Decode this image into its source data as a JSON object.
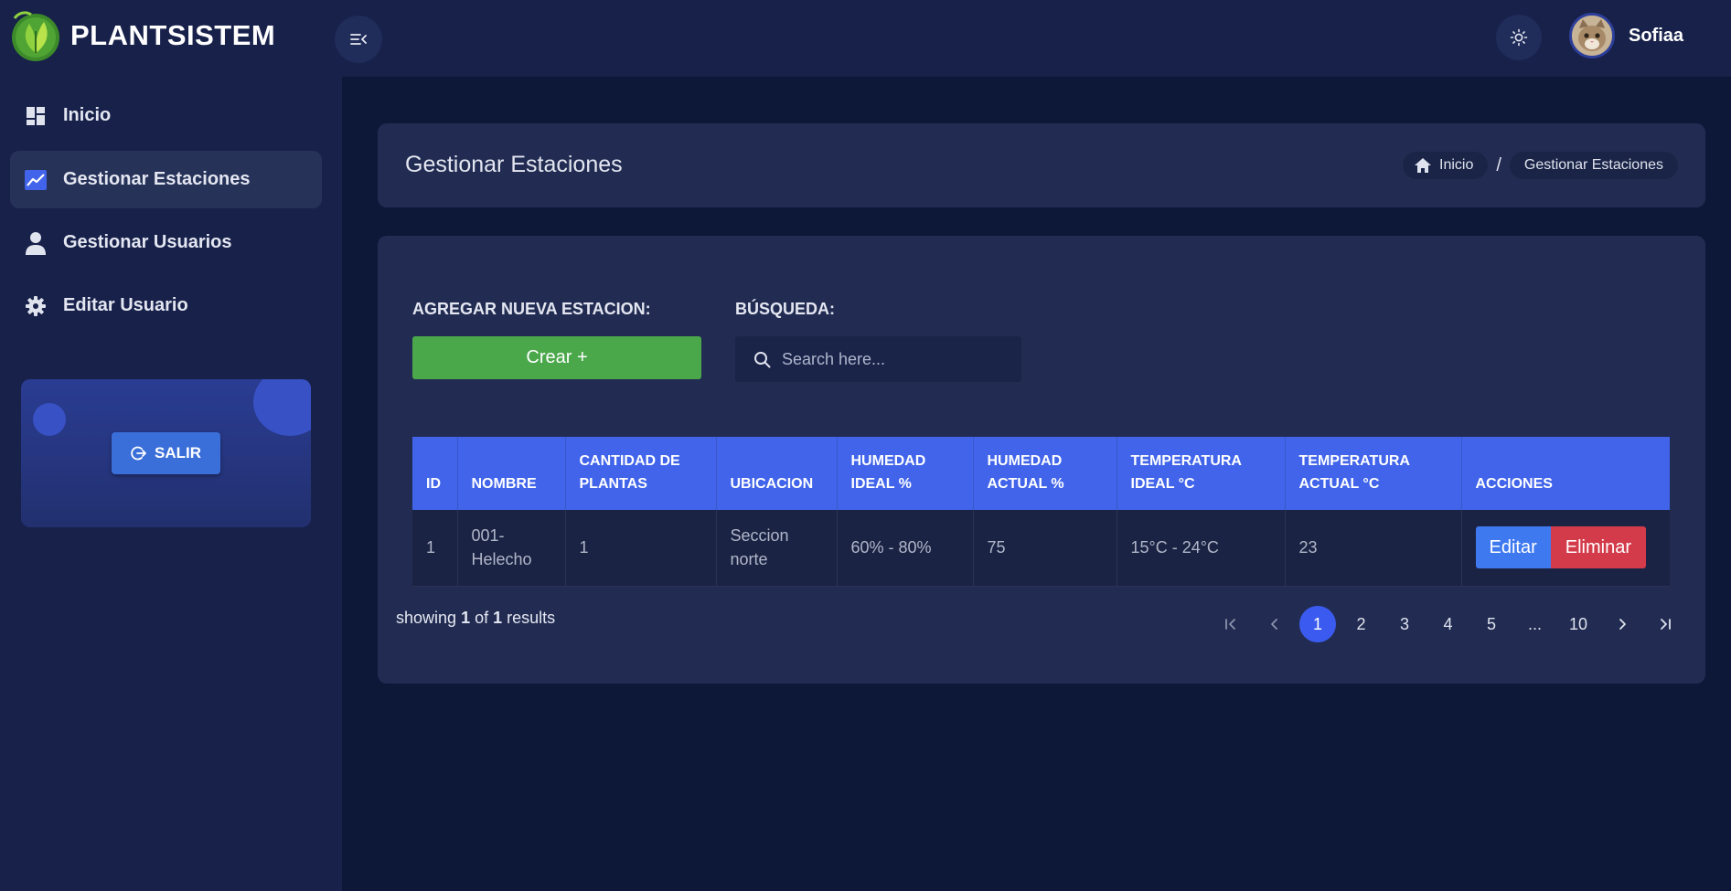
{
  "brand": {
    "name": "PLANTSISTEM"
  },
  "header": {
    "user_name": "Sofiaa"
  },
  "sidebar": {
    "items": [
      {
        "label": "Inicio",
        "icon": "dashboard-icon",
        "active": false
      },
      {
        "label": "Gestionar Estaciones",
        "icon": "chart-icon",
        "active": true
      },
      {
        "label": "Gestionar Usuarios",
        "icon": "user-icon",
        "active": false
      },
      {
        "label": "Editar Usuario",
        "icon": "gear-icon",
        "active": false
      }
    ],
    "logout_label": "SALIR"
  },
  "page": {
    "title": "Gestionar Estaciones",
    "breadcrumb": {
      "home": "Inicio",
      "separator": "/",
      "current": "Gestionar Estaciones"
    }
  },
  "toolbar": {
    "add_label": "AGREGAR NUEVA ESTACION:",
    "create_button": "Crear +",
    "search_label": "BÚSQUEDA:",
    "search_placeholder": "Search here..."
  },
  "table": {
    "headers": [
      "ID",
      "NOMBRE",
      "CANTIDAD DE PLANTAS",
      "UBICACION",
      "HUMEDAD IDEAL %",
      "HUMEDAD ACTUAL %",
      "TEMPERATURA IDEAL °C",
      "TEMPERATURA ACTUAL °C",
      "ACCIONES"
    ],
    "rows": [
      {
        "id": "1",
        "nombre": "001-Helecho",
        "cantidad": "1",
        "ubicacion": "Seccion norte",
        "humedad_ideal": "60% - 80%",
        "humedad_actual": "75",
        "temperatura_ideal": "15°C - 24°C",
        "temperatura_actual": "23",
        "edit_label": "Editar",
        "delete_label": "Eliminar"
      }
    ]
  },
  "footer": {
    "showing_prefix": "showing",
    "showing_count": "1",
    "showing_of": "of",
    "showing_total": "1",
    "showing_suffix": "results"
  },
  "pagination": {
    "pages": [
      "1",
      "2",
      "3",
      "4",
      "5",
      "...",
      "10"
    ],
    "current": "1"
  },
  "colors": {
    "accent": "#4164ea",
    "create": "#4aa84b",
    "edit": "#3f79f0",
    "delete": "#d33b4a",
    "background": "#0d1838",
    "panel": "#222c52"
  }
}
